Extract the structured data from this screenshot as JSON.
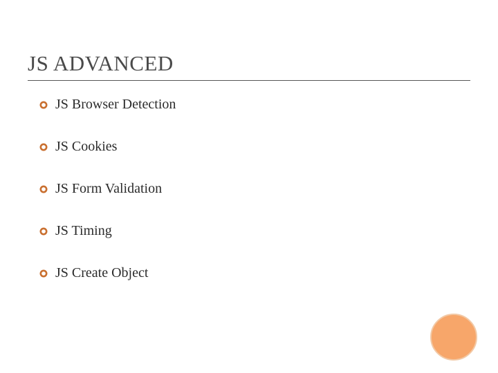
{
  "title": "JS ADVANCED",
  "items": [
    {
      "label": "JS Browser Detection"
    },
    {
      "label": "JS Cookies"
    },
    {
      "label": "JS Form Validation"
    },
    {
      "label": "JS Timing"
    },
    {
      "label": "JS Create Object"
    }
  ],
  "accent_color": "#f7a66a"
}
